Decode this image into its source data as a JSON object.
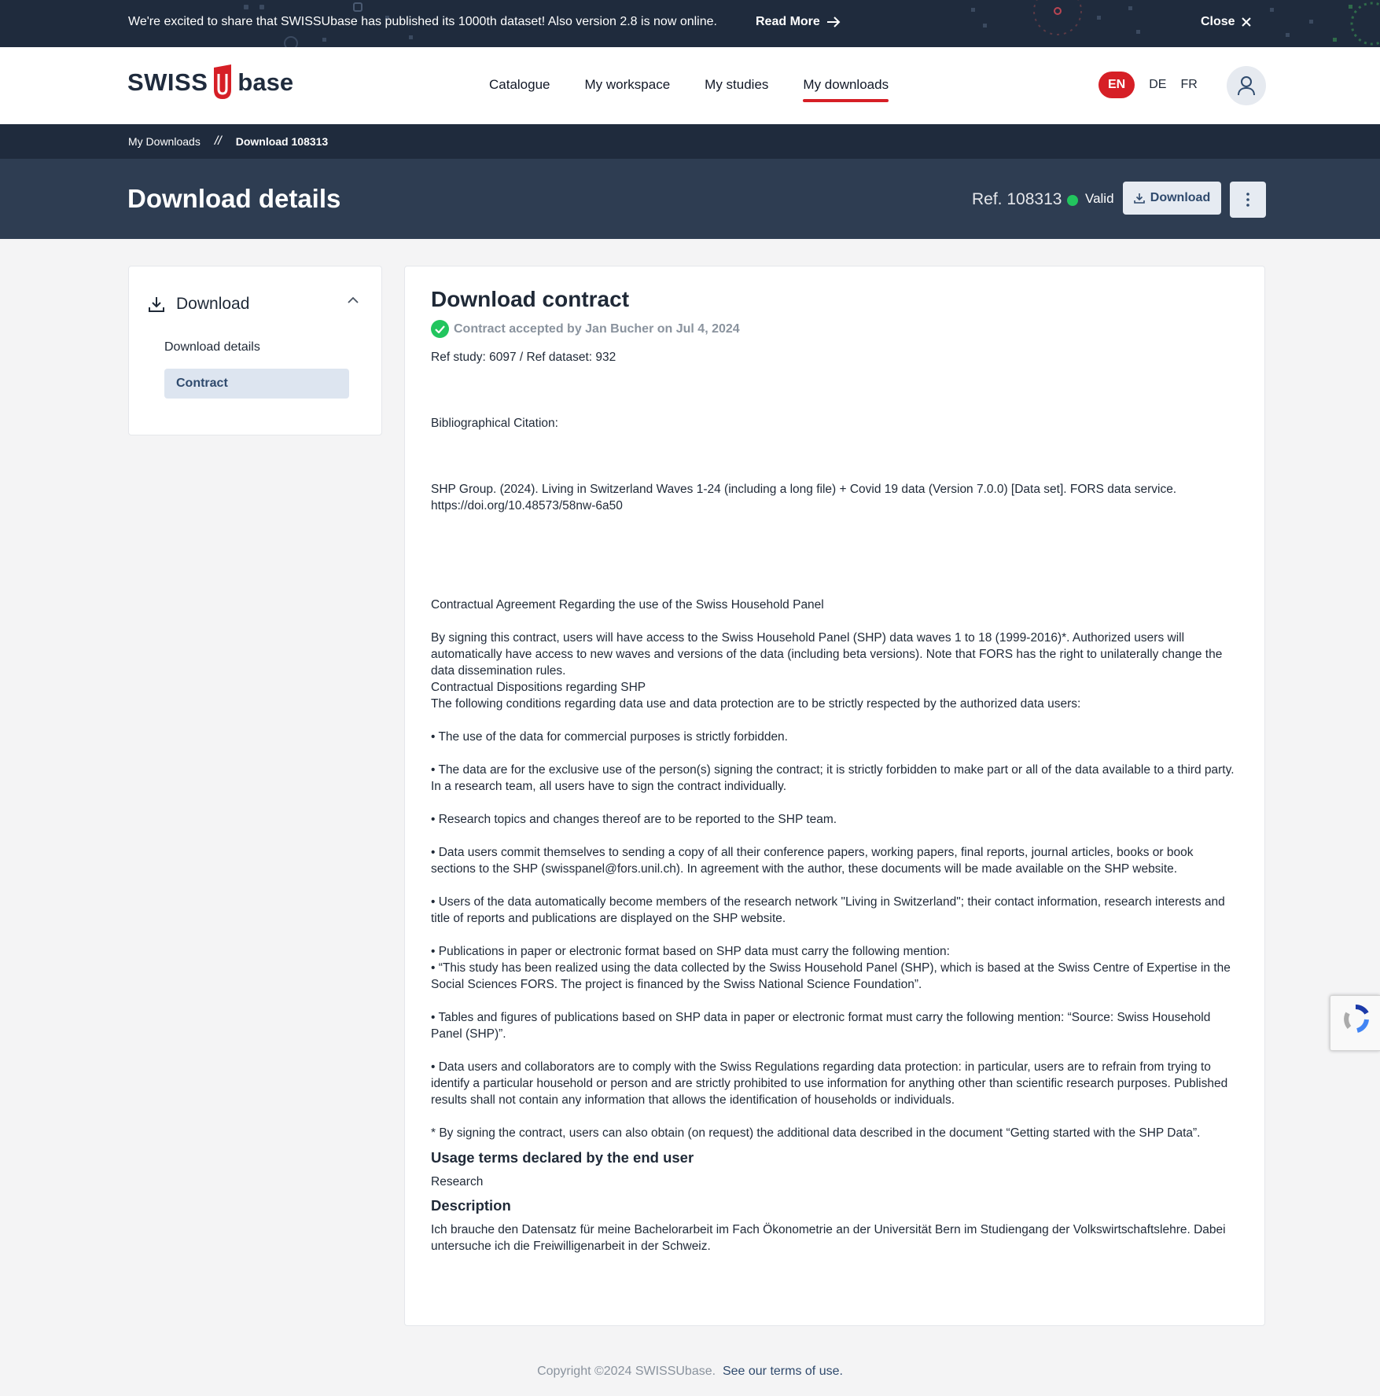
{
  "announcement": {
    "text": "We're excited to share that SWISSUbase has published its 1000th dataset! Also version 2.8 is now online.",
    "read_more": "Read More",
    "close": "Close"
  },
  "header": {
    "logo_left": "SWISS",
    "logo_right": "base",
    "nav": [
      "Catalogue",
      "My workspace",
      "My studies",
      "My downloads"
    ],
    "langs": [
      "EN",
      "DE",
      "FR"
    ]
  },
  "breadcrumb": {
    "root": "My Downloads",
    "separator": "//",
    "current": "Download 108313"
  },
  "title_band": {
    "title": "Download details",
    "ref": "Ref. 108313",
    "status": "Valid",
    "download_btn": "Download"
  },
  "sidebar": {
    "section": "Download",
    "items": [
      "Download details",
      "Contract"
    ]
  },
  "contract": {
    "title": "Download contract",
    "accepted": "Contract accepted by Jan Bucher on Jul 4, 2024",
    "ref_line": "Ref study: 6097 / Ref dataset: 932",
    "citation_label": "Bibliographical Citation:",
    "citation": "SHP Group. (2024). Living in Switzerland Waves 1-24 (including a long file) + Covid 19 data (Version 7.0.0) [Data set]. FORS data service.",
    "citation_url": "https://doi.org/10.48573/58nw-6a50",
    "agreement_title": "Contractual Agreement Regarding the use of the Swiss Household Panel",
    "intro": "By signing this contract, users will have access to the Swiss Household Panel (SHP) data waves 1 to 18 (1999-2016)*. Authorized users will automatically have access to new waves and versions of the data (including beta versions). Note that FORS has the right to unilaterally change the data dissemination rules.",
    "dispositions": "Contractual Dispositions regarding SHP",
    "conditions": "The following conditions regarding data use and data protection are to be strictly respected by the authorized data users:",
    "bullets": [
      "• The use of the data for commercial purposes is strictly forbidden.",
      "• The data are for the exclusive use of the person(s) signing the contract; it is strictly forbidden to make part or all of the data available to a third party. In a research team, all users have to sign the contract individually.",
      "• Research topics and changes thereof are to be reported to the SHP team.",
      "• Data users commit themselves to sending a copy of all their conference papers, working papers, final reports, journal articles, books or book sections to the SHP (swisspanel@fors.unil.ch). In agreement with the author, these documents will be made available on the SHP website.",
      "• Users of the data automatically become members of the research network \"Living in Switzerland\"; their contact information, research interests and title of reports and publications are displayed on the SHP website."
    ],
    "publications_line": "• Publications in paper or electronic format based on SHP data must carry the following mention:",
    "publications_quote": "• “This study has been realized using the data collected by the Swiss Household Panel (SHP), which is based at the Swiss Centre of Expertise in the Social Sciences FORS. The project is financed by the Swiss National Science Foundation”.",
    "tables": "• Tables and figures of publications based on SHP data in paper or electronic format must carry the following mention: “Source: Swiss Household Panel (SHP)”.",
    "protection": "• Data users and collaborators are to comply with the Swiss Regulations regarding data protection: in particular, users are to refrain from trying to identify a particular household or person and are strictly prohibited to use information for anything other than scientific research purposes. Published results shall not contain any information that allows the identification of households or individuals.",
    "footnote": "* By signing the contract, users can also obtain (on request) the additional data described in the document “Getting started with the SHP Data”.",
    "usage_heading": "Usage terms declared by the end user",
    "usage_value": "Research",
    "description_heading": "Description",
    "description_value": "Ich brauche den Datensatz für meine Bachelorarbeit im Fach Ökonometrie an der Universität Bern im Studiengang der Volkswirtschaftslehre. Dabei untersuche ich die Freiwilligenarbeit in der Schweiz."
  },
  "footer": {
    "copyright": "Copyright ©2024 SWISSUbase.",
    "terms": "See our terms of use."
  },
  "colors": {
    "navy": "#1f2b3d",
    "band": "#2e3d52",
    "accent_red": "#d61f26",
    "valid_green": "#22c55e"
  }
}
